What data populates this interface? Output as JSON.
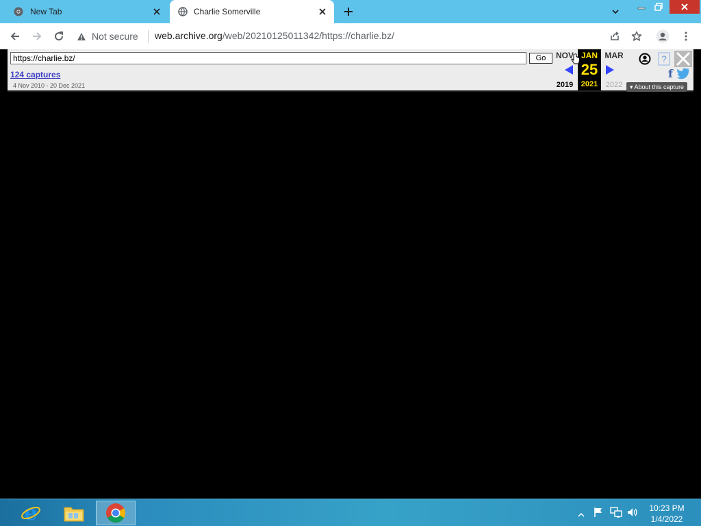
{
  "browser": {
    "tabs": [
      {
        "title": "New Tab",
        "favicon": "chrome-icon",
        "active": false
      },
      {
        "title": "Charlie Somerville",
        "favicon": "globe-icon",
        "active": true
      }
    ],
    "security_label": "Not secure",
    "url_host": "web.archive.org",
    "url_path": "/web/20210125011342/https://charlie.bz/"
  },
  "wayback": {
    "url_input": "https://charlie.bz/",
    "go_label": "Go",
    "captures_label": "124 captures",
    "range_label": "4 Nov 2010 - 20 Dec 2021",
    "prev_month": "NOV",
    "current_month": "JAN",
    "next_month": "MAR",
    "current_day": "25",
    "prev_year": "2019",
    "current_year": "2021",
    "next_year": "2022",
    "help_label": "?",
    "facebook_label": "f",
    "about_label": "▾ About this capture",
    "colors": {
      "current_bg": "#000000",
      "current_fg": "#ffe000",
      "arrow": "#3344ff"
    }
  },
  "taskbar": {
    "pinned": [
      "internet-explorer-icon",
      "file-explorer-icon",
      "chrome-icon"
    ],
    "clock_time": "10:23 PM",
    "clock_date": "1/4/2022"
  }
}
